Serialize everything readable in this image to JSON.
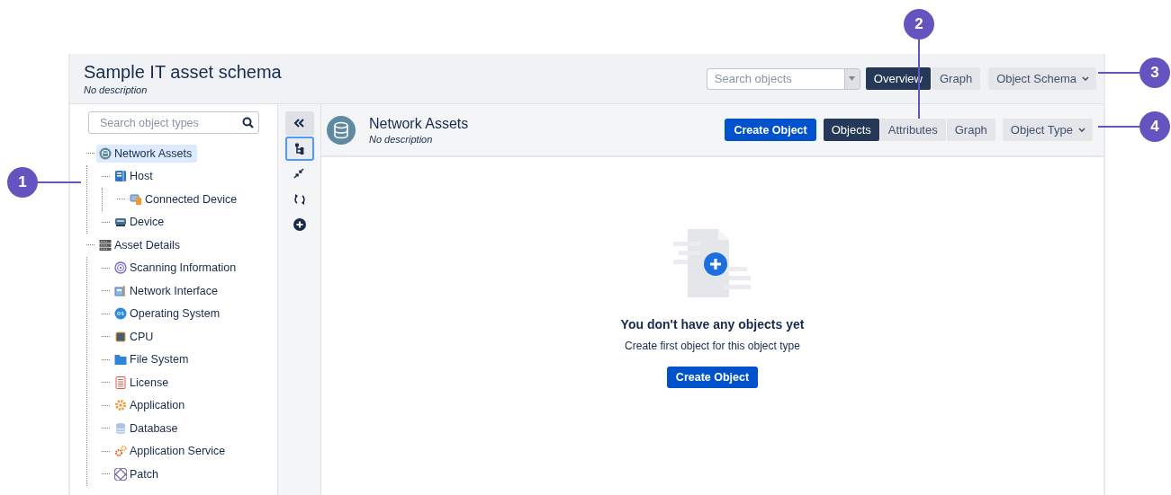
{
  "header": {
    "title": "Sample IT asset schema",
    "description": "No description",
    "search": {
      "placeholder": "Search objects"
    },
    "tabs": [
      {
        "label": "Overview",
        "selected": true
      },
      {
        "label": "Graph",
        "selected": false
      }
    ],
    "menu": {
      "label": "Object Schema"
    }
  },
  "tree": {
    "search": {
      "placeholder": "Search object types"
    },
    "items": [
      {
        "label": "Network Assets",
        "selected": true,
        "expanded": true,
        "children": [
          {
            "label": "Host",
            "selected": false,
            "expanded": true,
            "children": [
              {
                "label": "Connected Device",
                "selected": false
              }
            ]
          },
          {
            "label": "Device",
            "selected": false
          }
        ]
      },
      {
        "label": "Asset Details",
        "selected": false,
        "expanded": true,
        "children": [
          {
            "label": "Scanning Information",
            "selected": false
          },
          {
            "label": "Network Interface",
            "selected": false
          },
          {
            "label": "Operating System",
            "selected": false
          },
          {
            "label": "CPU",
            "selected": false
          },
          {
            "label": "File System",
            "selected": false
          },
          {
            "label": "License",
            "selected": false
          },
          {
            "label": "Application",
            "selected": false
          },
          {
            "label": "Database",
            "selected": false
          },
          {
            "label": "Application Service",
            "selected": false
          },
          {
            "label": "Patch",
            "selected": false
          }
        ]
      }
    ]
  },
  "tools": [
    {
      "selected": false
    },
    {
      "selected": true
    },
    {
      "selected": false
    },
    {
      "selected": false
    },
    {
      "selected": false
    }
  ],
  "object_type": {
    "title": "Network Assets",
    "description": "No description",
    "create_button": "Create Object",
    "tabs": [
      {
        "label": "Objects",
        "selected": true
      },
      {
        "label": "Attributes",
        "selected": false
      },
      {
        "label": "Graph",
        "selected": false
      }
    ],
    "menu": {
      "label": "Object Type"
    }
  },
  "empty_state": {
    "heading": "You don't have any objects yet",
    "text": "Create first object for this object type",
    "button": "Create Object"
  },
  "callouts": [
    {
      "number": "1"
    },
    {
      "number": "2"
    },
    {
      "number": "3"
    },
    {
      "number": "4"
    }
  ]
}
